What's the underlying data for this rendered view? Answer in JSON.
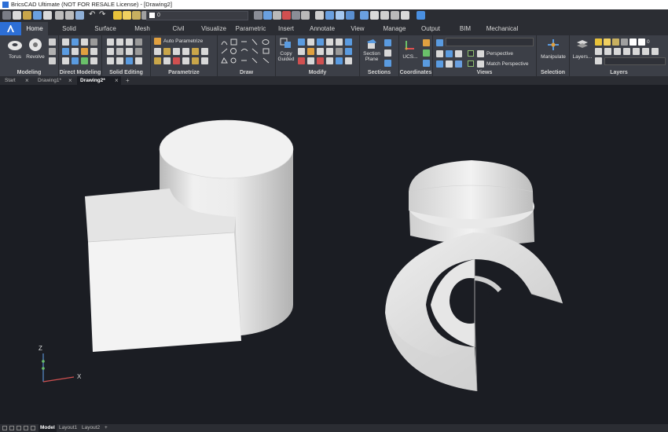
{
  "window": {
    "title": "BricsCAD Ultimate (NOT FOR RESALE License) - [Drawing2]"
  },
  "quick_access": {
    "layer_value": "0"
  },
  "ribbon_tabs": [
    "Home",
    "Solid",
    "Surface",
    "Mesh",
    "Civil",
    "Visualize",
    "Parametric",
    "Insert",
    "Annotate",
    "View",
    "Manage",
    "Output",
    "BIM",
    "Mechanical"
  ],
  "ribbon": {
    "modeling": {
      "title": "Modeling",
      "torus": "Torus",
      "revolve": "Revolve"
    },
    "direct_modeling": {
      "title": "Direct Modeling"
    },
    "solid_editing": {
      "title": "Solid Editing"
    },
    "parametrize": {
      "title": "Parametrize",
      "auto": "Auto Parametrize"
    },
    "draw": {
      "title": "Draw"
    },
    "modify": {
      "title": "Modify",
      "copy_guided": [
        "Copy",
        "Guided"
      ]
    },
    "sections": {
      "title": "Sections",
      "section_plane": [
        "Section",
        "Plane"
      ]
    },
    "coordinates": {
      "title": "Coordinates",
      "ucs": "UCS..."
    },
    "views": {
      "title": "Views",
      "perspective": "Perspective",
      "match_perspective": "Match Perspective"
    },
    "selection": {
      "title": "Selection",
      "manipulate": "Manipulate"
    },
    "layers": {
      "title": "Layers",
      "layers_btn": "Layers...",
      "layer_value": "0"
    }
  },
  "doc_tabs": [
    "Start",
    "Drawing1*",
    "Drawing2*"
  ],
  "layout_tabs": [
    "Model",
    "Layout1",
    "Layout2"
  ],
  "ucs": {
    "x": "X",
    "y": "Y",
    "z": "Z"
  },
  "colors": {
    "accent": "#2d6fd6",
    "canvas": "#1b1d23",
    "ribbon": "#3c3f47"
  }
}
